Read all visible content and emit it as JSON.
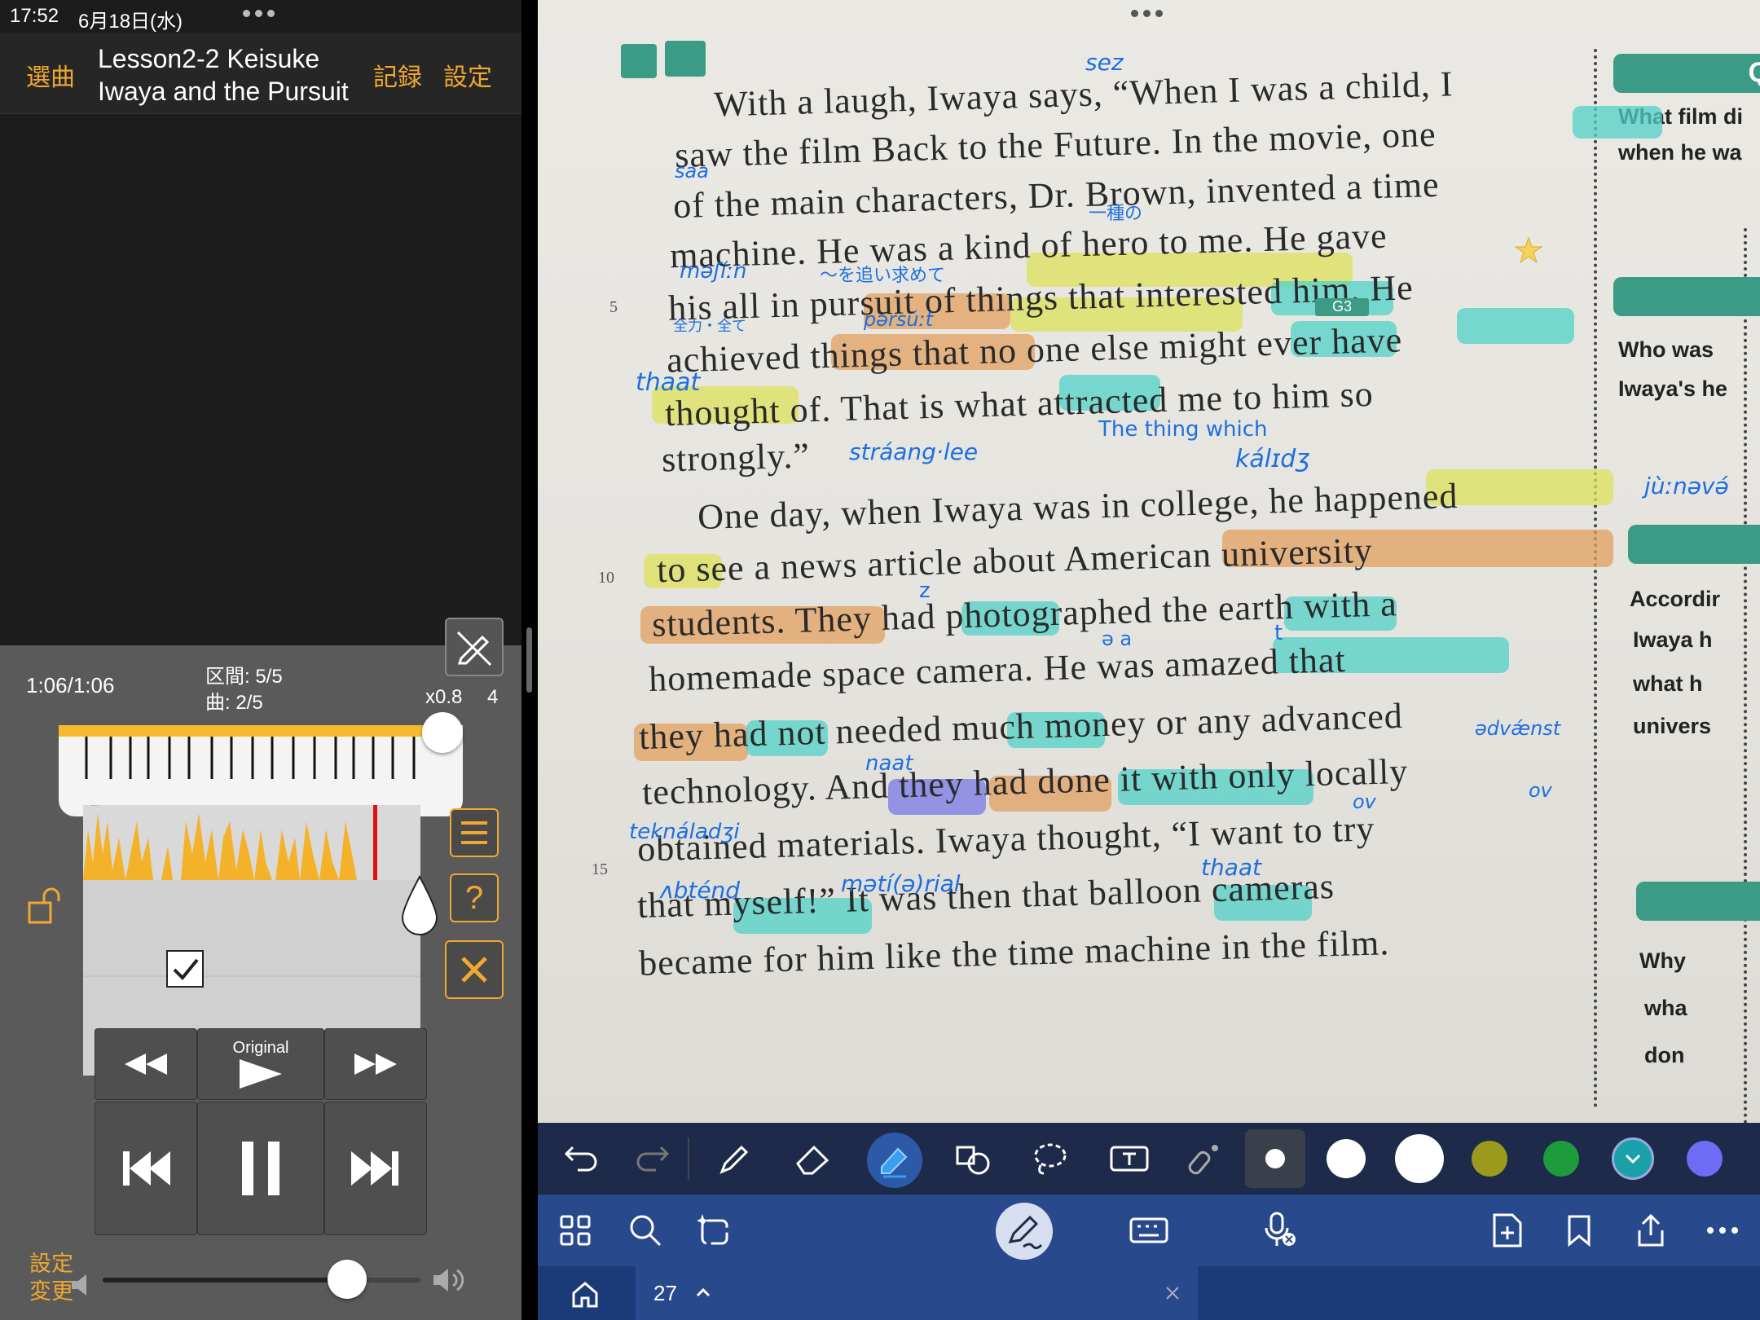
{
  "status": {
    "time": "17:52",
    "date": "6月18日(水)"
  },
  "nav": {
    "select_song": "選曲",
    "title_line1": "Lesson2-2 Keisuke",
    "title_line2": "Iwaya and the Pursuit",
    "record": "記録",
    "settings": "設定"
  },
  "player": {
    "elapsed": "1:06/1:06",
    "section": "区間: 5/5",
    "song": "曲: 2/5",
    "speed": "x0.8",
    "speed_extra": "4",
    "original_label": "Original",
    "settings_change": "設定\n変更"
  },
  "page": {
    "lines": [
      "With a laugh, Iwaya says, “When I was a child, I",
      "saw the film Back to the Future.  In the movie, one",
      "of the main characters, Dr. Brown, invented a time",
      "machine.  He was a kind of hero to me.  He gave",
      "his all in pursuit of things that interested him.  He",
      "achieved things that no one else might ever have",
      "thought of.  That is what attracted me to him so",
      "strongly.”",
      "One day, when Iwaya was in college, he happened",
      "to see a news article about American university",
      "students.  They had photographed the earth with a",
      "homemade space camera.  He was amazed that",
      "they had not needed much money or any advanced",
      "technology.  And they had done it with only locally",
      "obtained materials.  Iwaya thought, “I want to try",
      "that myself!”  It was then that balloon cameras",
      "became for him like the time machine in the film."
    ],
    "line_numbers": [
      "5",
      "10",
      "15"
    ],
    "annotations": {
      "sez": "sez",
      "saa": "saa",
      "isshu": "一種の",
      "mashin": "məʃíːn",
      "oimotomete": "〜を追い求めて",
      "pursuit": "pərsúːt",
      "zenryoku": "全力・全て",
      "g3": "G3",
      "thaat": "thaat",
      "thing_which": "The thing which",
      "strang": "stráang·lee",
      "kalidz": "kálɪdʒ",
      "junav": "jùːnəvə́",
      "z": "z",
      "t": "t",
      "aa": "ə  a",
      "advaenst": "ədvǽnst",
      "naat": "naat",
      "teknaladzi": "teknáladʒi",
      "ov1": "ov",
      "ov2": "ov",
      "thaat2": "thaat",
      "abtend": "ʌbténd",
      "matirial": "mətí(ə)rial"
    },
    "side_texts": [
      "What film di",
      "when he wa",
      "Who was",
      "Iwaya's he",
      "Accordir",
      "Iwaya h",
      "what h",
      "univers",
      "Why",
      "wha",
      "don"
    ],
    "side_top_letter": "Q"
  },
  "toolbar": {
    "colors": [
      "#ffffff",
      "#ffffff",
      "#ffffff",
      "#9c9a1c",
      "#1e9c3c",
      "#1aa0a8",
      "#6c6cf4"
    ]
  },
  "tabbar": {
    "page_label": "27"
  }
}
